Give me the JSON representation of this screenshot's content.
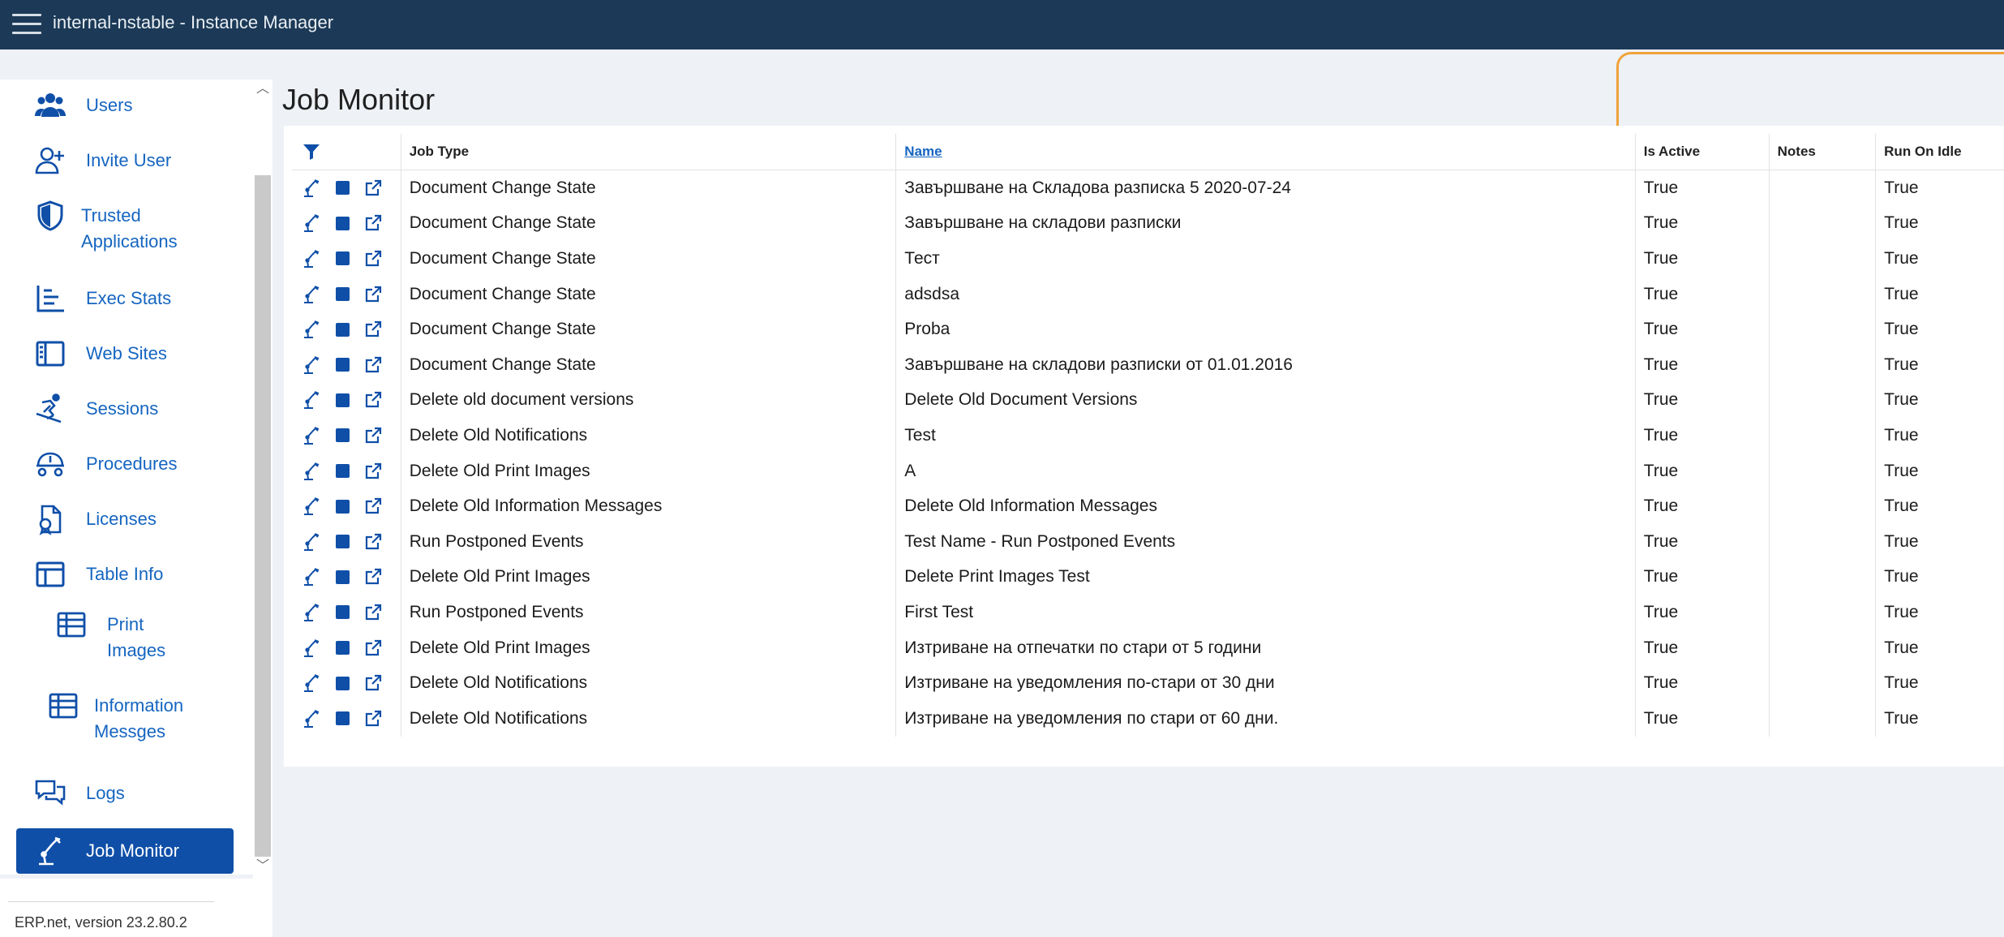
{
  "header": {
    "title": "internal-nstable - Instance Manager"
  },
  "sidebar": {
    "items": [
      {
        "label": "Users",
        "icon": "users-icon"
      },
      {
        "label": "Invite User",
        "icon": "user-plus-icon"
      },
      {
        "label": "Trusted Applications",
        "icon": "shield-icon"
      },
      {
        "label": "Exec Stats",
        "icon": "bar-chart-icon"
      },
      {
        "label": "Web Sites",
        "icon": "website-icon"
      },
      {
        "label": "Sessions",
        "icon": "snowboarder-icon"
      },
      {
        "label": "Procedures",
        "icon": "procedures-icon"
      },
      {
        "label": "Licenses",
        "icon": "license-icon"
      },
      {
        "label": "Table Info",
        "icon": "table-icon"
      },
      {
        "label": "Print Images",
        "icon": "grid-table-icon"
      },
      {
        "label": "Information Messges",
        "icon": "grid-table-icon"
      },
      {
        "label": "Logs",
        "icon": "chat-bubbles-icon"
      },
      {
        "label": "Job Monitor",
        "icon": "robot-arm-icon"
      }
    ],
    "active": "Job Monitor",
    "version": "ERP.net, version 23.2.80.2"
  },
  "main": {
    "title": "Job Monitor",
    "columns": {
      "job_type": "Job Type",
      "name": "Name",
      "is_active": "Is Active",
      "notes": "Notes",
      "run_on_idle": "Run On Idle"
    },
    "rows": [
      {
        "job_type": "Document Change State",
        "name": "Завършване на Складова разписка 5 2020-07-24",
        "is_active": "True",
        "notes": "",
        "run_on_idle": "True"
      },
      {
        "job_type": "Document Change State",
        "name": "Завършване на складови разписки",
        "is_active": "True",
        "notes": "",
        "run_on_idle": "True"
      },
      {
        "job_type": "Document Change State",
        "name": "Тест",
        "is_active": "True",
        "notes": "",
        "run_on_idle": "True"
      },
      {
        "job_type": "Document Change State",
        "name": "adsdsa",
        "is_active": "True",
        "notes": "",
        "run_on_idle": "True"
      },
      {
        "job_type": "Document Change State",
        "name": "Proba",
        "is_active": "True",
        "notes": "",
        "run_on_idle": "True"
      },
      {
        "job_type": "Document Change State",
        "name": "Завършване на складови разписки от 01.01.2016",
        "is_active": "True",
        "notes": "",
        "run_on_idle": "True"
      },
      {
        "job_type": "Delete old document versions",
        "name": "Delete Old Document Versions",
        "is_active": "True",
        "notes": "",
        "run_on_idle": "True"
      },
      {
        "job_type": "Delete Old Notifications",
        "name": "Test",
        "is_active": "True",
        "notes": "",
        "run_on_idle": "True"
      },
      {
        "job_type": "Delete Old Print Images",
        "name": "A",
        "is_active": "True",
        "notes": "",
        "run_on_idle": "True"
      },
      {
        "job_type": "Delete Old Information Messages",
        "name": "Delete Old Information Messages",
        "is_active": "True",
        "notes": "",
        "run_on_idle": "True"
      },
      {
        "job_type": "Run Postponed Events",
        "name": "Test Name - Run Postponed Events",
        "is_active": "True",
        "notes": "",
        "run_on_idle": "True"
      },
      {
        "job_type": "Delete Old Print Images",
        "name": "Delete Print Images Test",
        "is_active": "True",
        "notes": "",
        "run_on_idle": "True"
      },
      {
        "job_type": "Run Postponed Events",
        "name": "First Test",
        "is_active": "True",
        "notes": "",
        "run_on_idle": "True"
      },
      {
        "job_type": "Delete Old Print Images",
        "name": "Изтриване на отпечатки по стари от 5 години",
        "is_active": "True",
        "notes": "",
        "run_on_idle": "True"
      },
      {
        "job_type": "Delete Old Notifications",
        "name": "Изтриване на уведомления по-стари от 30 дни",
        "is_active": "True",
        "notes": "",
        "run_on_idle": "True"
      },
      {
        "job_type": "Delete Old Notifications",
        "name": "Изтриване на уведомления по стари от 60 дни.",
        "is_active": "True",
        "notes": "",
        "run_on_idle": "True"
      }
    ]
  },
  "colors": {
    "topbar": "#1c3a57",
    "accent": "#0f4fa8",
    "link": "#1565c0",
    "highlight_frame": "#f0a23a",
    "background": "#eef1f6"
  }
}
